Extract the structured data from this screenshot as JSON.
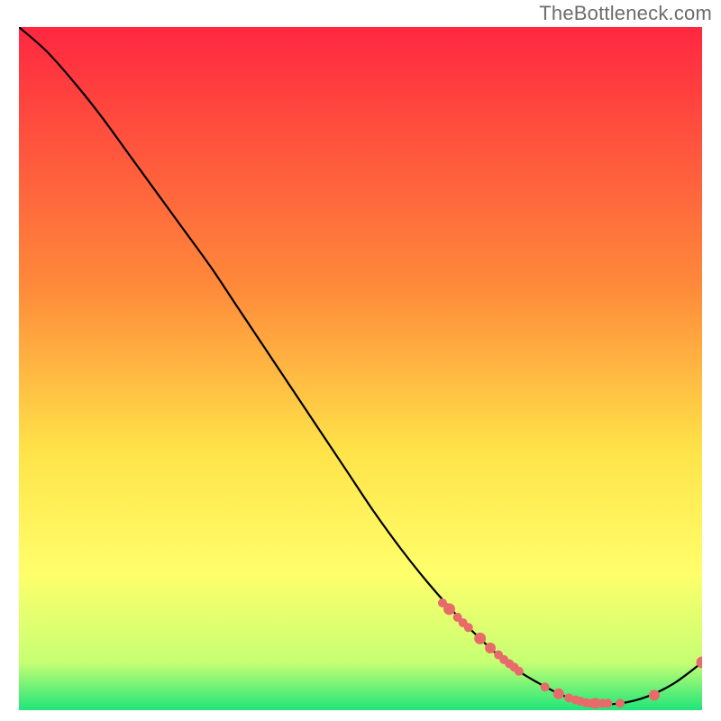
{
  "watermark": "TheBottleneck.com",
  "chart_data": {
    "type": "line",
    "title": "",
    "xlabel": "",
    "ylabel": "",
    "xlim": [
      0,
      100
    ],
    "ylim": [
      0,
      100
    ],
    "gradient_background": {
      "top": "#ff2740",
      "mid1": "#ff8a3a",
      "mid2": "#ffe349",
      "mid3": "#ffff6b",
      "mid4": "#c6ff73",
      "bottom": "#20e57a"
    },
    "series": [
      {
        "name": "curve",
        "type": "line",
        "color": "#000000",
        "x": [
          0,
          4,
          8,
          12,
          16,
          20,
          24,
          28,
          32,
          36,
          40,
          44,
          48,
          52,
          56,
          60,
          64,
          68,
          72,
          76,
          80,
          84,
          88,
          92,
          96,
          100
        ],
        "y": [
          100,
          96.5,
          92,
          87,
          81.5,
          76,
          70.5,
          65,
          59,
          53,
          47,
          41,
          35,
          29,
          23.5,
          18.5,
          14,
          10,
          6.5,
          4,
          2,
          1,
          1,
          2,
          4,
          7
        ]
      },
      {
        "name": "highlight-points",
        "type": "scatter",
        "color": "#e96a6a",
        "x": [
          62,
          63,
          64.2,
          65,
          65.8,
          67.5,
          69,
          70.2,
          71,
          71.8,
          72.5,
          73.2,
          77,
          79,
          80.5,
          81.5,
          82.2,
          83,
          83.8,
          84.4,
          85.4,
          86.2,
          88,
          93,
          100
        ],
        "y": [
          15.7,
          14.8,
          13.6,
          12.8,
          12.1,
          10.5,
          9.1,
          8.1,
          7.4,
          6.8,
          6.3,
          5.7,
          3.4,
          2.4,
          1.8,
          1.5,
          1.3,
          1.1,
          1.0,
          1.0,
          1.0,
          1.0,
          1.0,
          2.2,
          7.0
        ],
        "r": [
          5,
          6.5,
          5,
          5,
          5,
          6.5,
          6,
          5,
          5,
          5,
          5,
          5,
          5,
          6,
          5,
          5,
          5,
          5,
          5,
          6,
          5,
          5,
          5,
          6,
          6.5
        ]
      }
    ]
  }
}
